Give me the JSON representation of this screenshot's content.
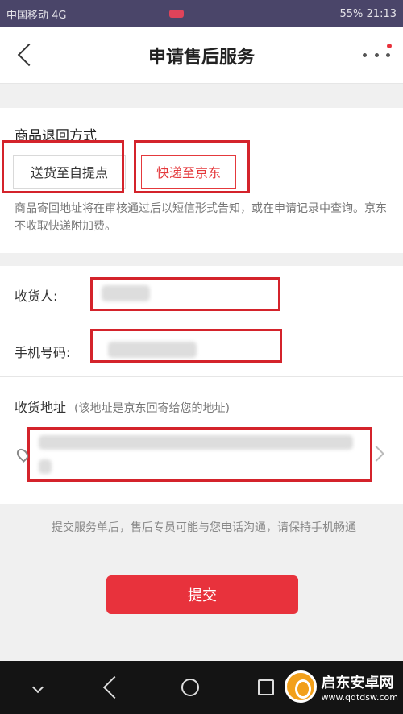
{
  "status_bar": {
    "left": "中国移动 4G",
    "right": "55% 21:13"
  },
  "header": {
    "title": "申请售后服务"
  },
  "return_method": {
    "title": "商品退回方式",
    "options": [
      "送货至自提点",
      "快递至京东"
    ],
    "note": "商品寄回地址将在审核通过后以短信形式告知，或在申请记录中查询。京东不收取快递附加费。"
  },
  "form": {
    "receiver_label": "收货人:",
    "phone_label": "手机号码:",
    "address_label": "收货地址",
    "address_hint": "(该地址是京东回寄给您的地址)"
  },
  "footer_note": "提交服务单后，售后专员可能与您电话沟通，请保持手机畅通",
  "submit_label": "提交",
  "watermark": {
    "title": "启东安卓网",
    "url": "www.qdtdsw.com"
  },
  "colors": {
    "accent": "#e8323c",
    "status_bar": "#4a4569",
    "annotation": "#d4232b"
  }
}
